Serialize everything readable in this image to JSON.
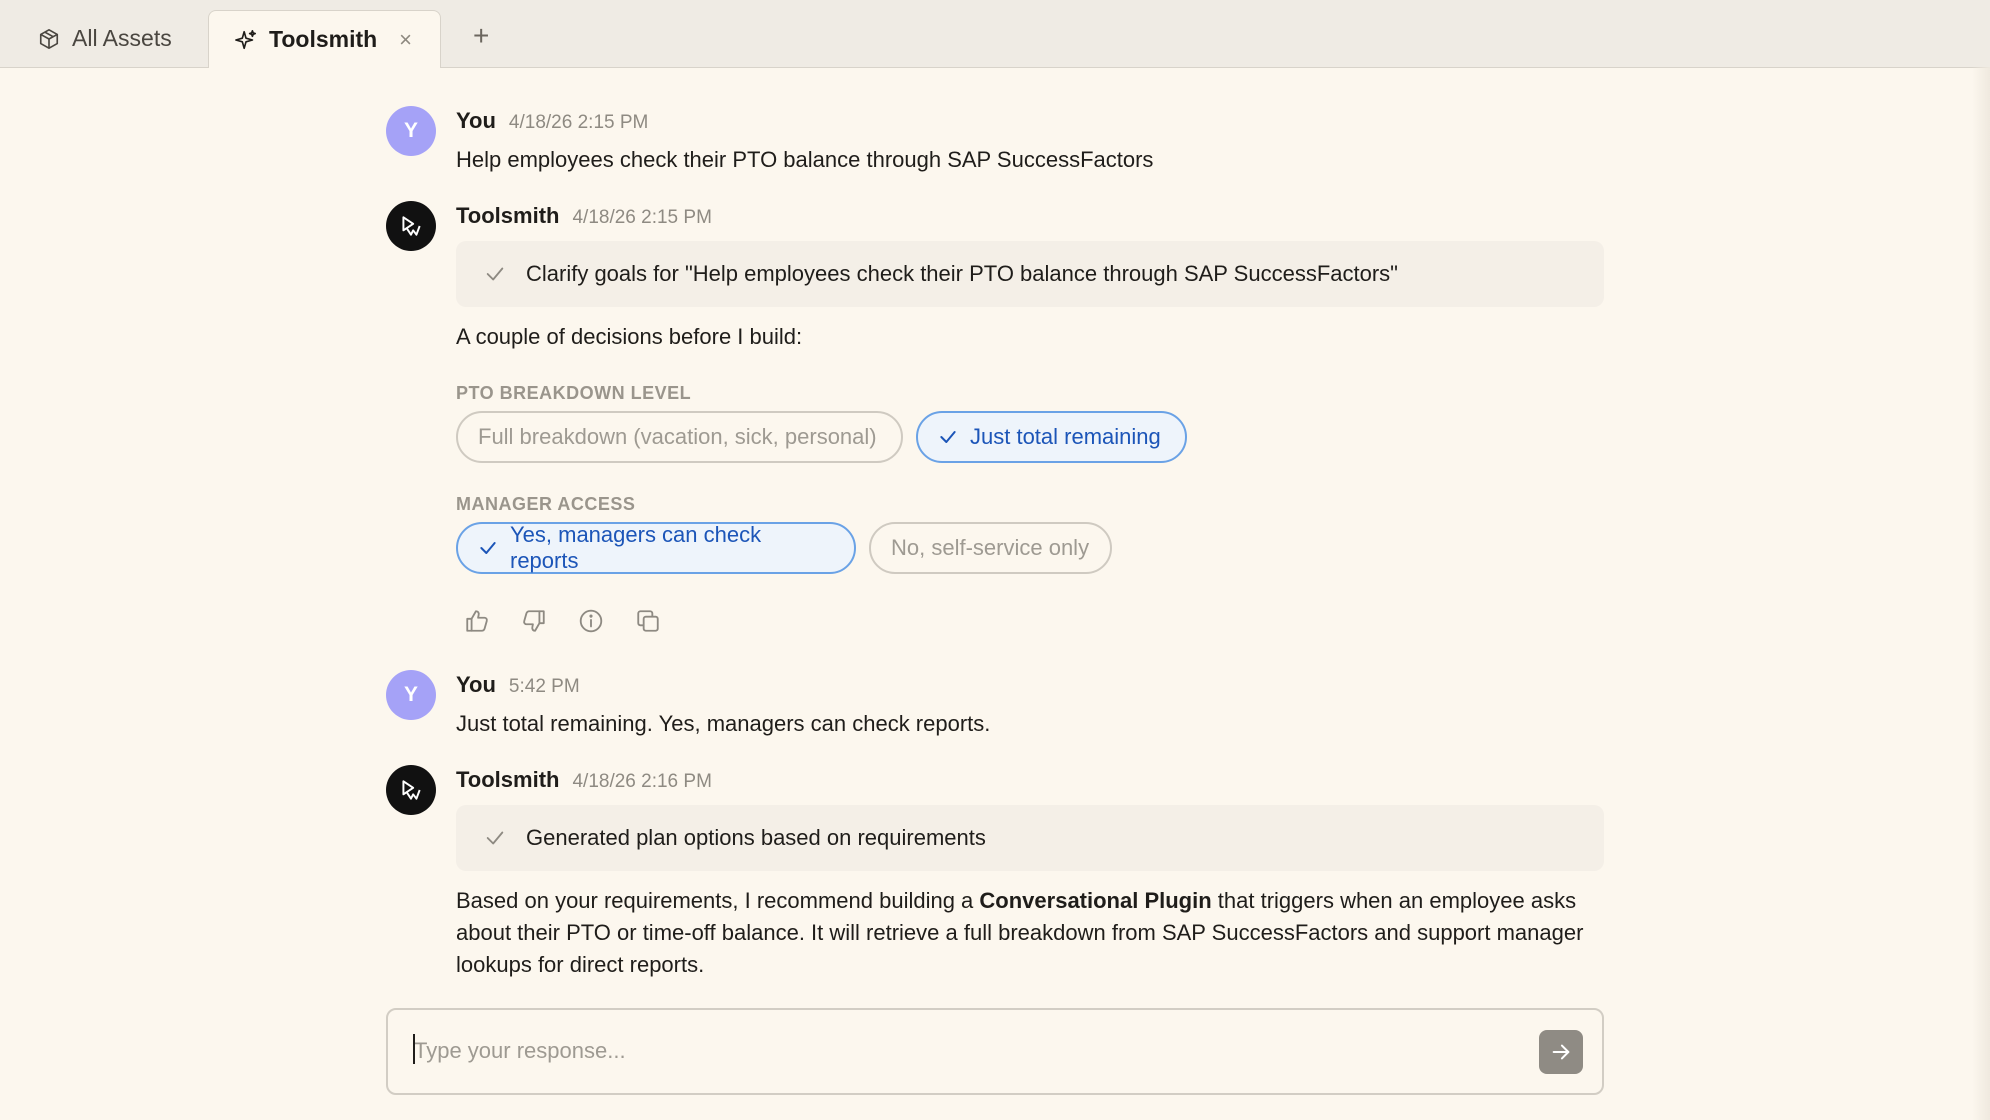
{
  "tabs": {
    "all_assets": "All Assets",
    "toolsmith": "Toolsmith",
    "close": "×",
    "new": "+"
  },
  "messages": [
    {
      "author": "You",
      "time": "4/18/26 2:15 PM",
      "avatar": "Y",
      "text": "Help employees check their PTO balance through SAP SuccessFactors"
    },
    {
      "author": "Toolsmith",
      "time": "4/18/26 2:15 PM",
      "step": "Clarify goals for \"Help employees check their PTO balance through SAP SuccessFactors\"",
      "intro": "A couple of decisions before I build:"
    },
    {
      "author": "You",
      "time": "5:42 PM",
      "avatar": "Y",
      "text": "Just total remaining. Yes, managers can check reports."
    },
    {
      "author": "Toolsmith",
      "time": "4/18/26 2:16 PM",
      "step": "Generated plan options based on requirements",
      "body_pre": "Based on your requirements, I recommend building a ",
      "body_bold": "Conversational Plugin",
      "body_line1_post": " that triggers when an employee asks",
      "body_line2": "about their PTO or time-off balance. It will retrieve a full breakdown from SAP SuccessFactors and support manager",
      "body_line3": "lookups for direct reports."
    }
  ],
  "decisions": {
    "pto": {
      "label": "PTO BREAKDOWN LEVEL",
      "options": [
        "Full breakdown (vacation, sick, personal)",
        "Just total remaining"
      ],
      "selected": "Just total remaining"
    },
    "manager": {
      "label": "MANAGER ACCESS",
      "options": [
        "Yes, managers can check reports",
        "No, self-service only"
      ],
      "selected": "Yes, managers can check reports"
    }
  },
  "actions": [
    "thumbs-up-icon",
    "thumbs-down-icon",
    "info-icon",
    "copy-icon"
  ],
  "composer": {
    "placeholder": "Type your response..."
  },
  "colors": {
    "accent": "#1c55b8",
    "user_avatar": "#a5a2f7",
    "background": "#fcf7ee"
  }
}
